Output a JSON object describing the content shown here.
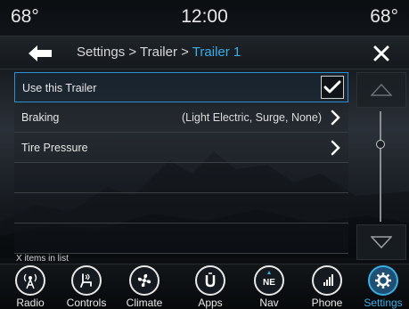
{
  "status": {
    "temp_left": "68°",
    "time": "12:00",
    "temp_right": "68°"
  },
  "header": {
    "crumb_prefix": "Settings > Trailer > ",
    "crumb_current": "Trailer 1",
    "back_icon": "back-arrow-icon",
    "close_icon": "close-icon"
  },
  "list": {
    "rows": [
      {
        "label": "Use this Trailer",
        "checked": true
      },
      {
        "label": "Braking",
        "value": "(Light Electric, Surge, None)"
      },
      {
        "label": "Tire Pressure"
      }
    ],
    "count_text": "X items in list"
  },
  "nav": {
    "items": [
      {
        "label": "Radio",
        "icon": "radio-antenna-icon"
      },
      {
        "label": "Controls",
        "icon": "seat-controls-icon"
      },
      {
        "label": "Climate",
        "icon": "climate-fan-icon"
      },
      {
        "label": "Apps",
        "icon": "apps-u-icon"
      },
      {
        "label": "Nav",
        "icon": "compass-ne-icon",
        "glyph": "NE"
      },
      {
        "label": "Phone",
        "icon": "phone-signal-icon"
      },
      {
        "label": "Settings",
        "icon": "gear-icon",
        "active": true
      }
    ]
  },
  "colors": {
    "accent": "#3aaee6",
    "selected_border": "#2f8fd0"
  }
}
